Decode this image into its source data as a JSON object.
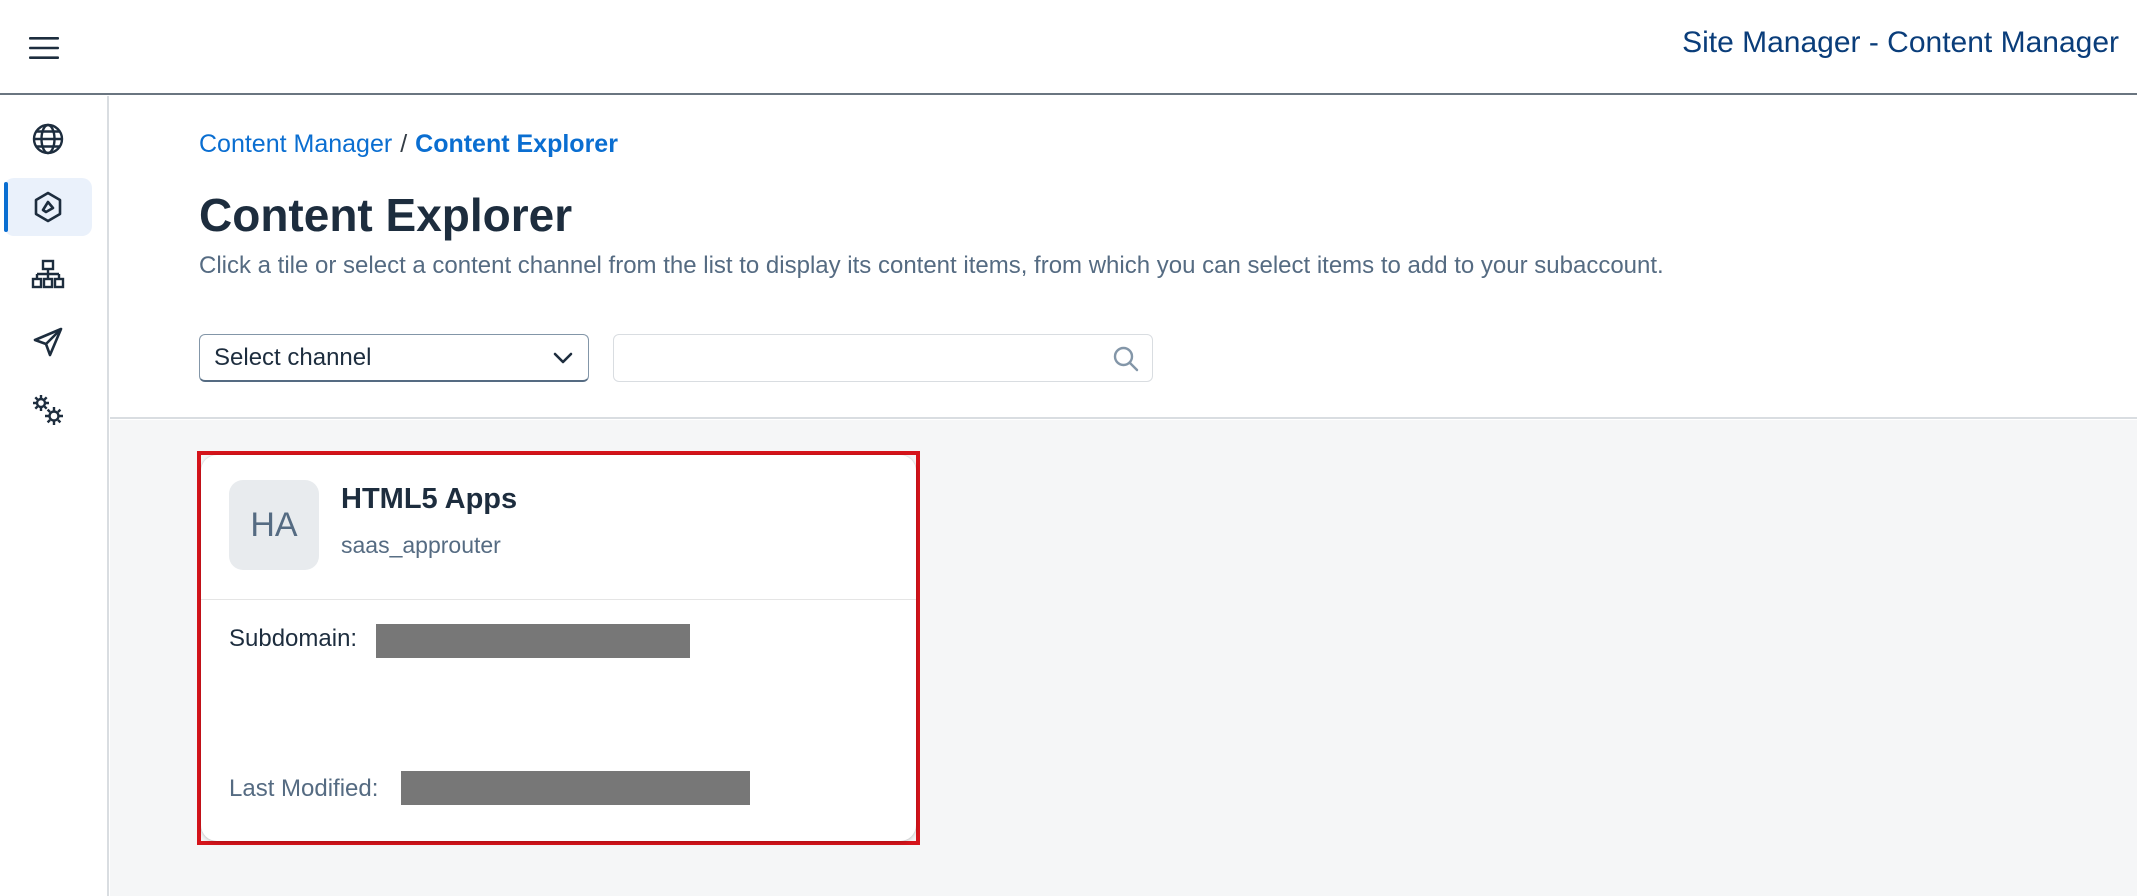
{
  "shell": {
    "title": "Site Manager - Content Manager"
  },
  "side_nav": {
    "items": [
      {
        "icon": "globe-icon",
        "active": false
      },
      {
        "icon": "content-manager-icon",
        "active": true
      },
      {
        "icon": "hierarchy-icon",
        "active": false
      },
      {
        "icon": "paper-plane-icon",
        "active": false
      },
      {
        "icon": "settings-gears-icon",
        "active": false
      }
    ]
  },
  "breadcrumb": {
    "parent": "Content Manager",
    "separator": "/",
    "current": "Content Explorer"
  },
  "page": {
    "title": "Content Explorer",
    "description": "Click a tile or select a content channel from the list to display its content items, from which you can select items to add to your subaccount."
  },
  "filters": {
    "channel_select_value": "Select channel",
    "search_value": "",
    "search_placeholder": ""
  },
  "tiles": [
    {
      "avatar": "HA",
      "title": "HTML5 Apps",
      "subtitle": "saas_approuter",
      "subdomain_label": "Subdomain:",
      "last_modified_label": "Last Modified:"
    }
  ],
  "colors": {
    "shell_title": "#0a3d7a",
    "link": "#0a6ed1",
    "heading": "#1d2d3e",
    "secondary_text": "#556b82",
    "highlight_border": "#d5141b",
    "redaction": "#777777",
    "body_background": "#f5f6f7"
  }
}
